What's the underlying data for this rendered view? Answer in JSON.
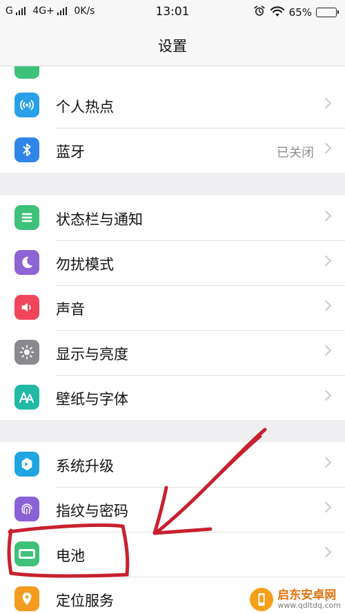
{
  "status_bar": {
    "carrier1": "G",
    "carrier2": "4G+",
    "speed": "0K/s",
    "time": "13:01",
    "battery_percent": "65%",
    "battery_level": 0.65,
    "battery_color": "#f2c21a"
  },
  "header": {
    "title": "设置"
  },
  "groups": [
    {
      "items": [
        {
          "label": "个人热点",
          "icon": "hotspot-icon",
          "color": "#2aa0e8"
        },
        {
          "label": "蓝牙",
          "icon": "bluetooth-icon",
          "color": "#2f86e6",
          "value": "已关闭"
        }
      ]
    },
    {
      "items": [
        {
          "label": "状态栏与通知",
          "icon": "notification-icon",
          "color": "#3ec178"
        },
        {
          "label": "勿扰模式",
          "icon": "moon-icon",
          "color": "#8e63d4"
        },
        {
          "label": "声音",
          "icon": "speaker-icon",
          "color": "#f0455b"
        },
        {
          "label": "显示与亮度",
          "icon": "brightness-icon",
          "color": "#8a8a8e"
        },
        {
          "label": "壁纸与字体",
          "icon": "wallpaper-font-icon",
          "color": "#22b8a6"
        }
      ]
    },
    {
      "items": [
        {
          "label": "系统升级",
          "icon": "system-update-icon",
          "color": "#1fa6e0"
        },
        {
          "label": "指纹与密码",
          "icon": "fingerprint-icon",
          "color": "#8a62d6"
        },
        {
          "label": "电池",
          "icon": "battery-icon",
          "color": "#3ec178"
        },
        {
          "label": "定位服务",
          "icon": "location-icon",
          "color": "#f39c1f"
        }
      ]
    }
  ],
  "annotation_color": "#c8202f",
  "watermark": {
    "title": "启东安卓网",
    "url": "www.qdltdq.com"
  }
}
